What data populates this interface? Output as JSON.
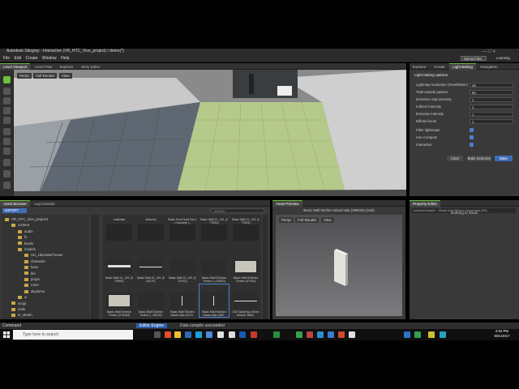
{
  "window": {
    "title": "Autodesk Stingray - Interactive (VR_HTC_Vive_project) / demo(*)",
    "account": "Samuel Ma",
    "learning": "Learning"
  },
  "menu": [
    "File",
    "Edit",
    "Create",
    "Window",
    "Help"
  ],
  "top_tabs": {
    "left": [
      "Level Viewport",
      "Level Flow",
      "Explorer",
      "Story Editor"
    ],
    "right": [
      "Explorer",
      "Create",
      "Light Baking",
      "Navigation"
    ]
  },
  "viewport": {
    "buttons": [
      "Persp",
      "Full Render",
      "View"
    ]
  },
  "light_baking": {
    "section": "Light baking options",
    "rows": [
      {
        "label": "Lightmap resolution (Texel/Meter)",
        "value": "16"
      },
      {
        "label": "Total sample passes",
        "value": "64"
      },
      {
        "label": "Emissive map intensity",
        "value": "1"
      },
      {
        "label": "Indirect intensity",
        "value": "1"
      },
      {
        "label": "Emissive intensity",
        "value": "1"
      },
      {
        "label": "Diffuse boost",
        "value": "1"
      }
    ],
    "checks": [
      "Filter lightmaps",
      "Use Compute",
      "Interactive"
    ],
    "buttons": {
      "clear": "Clear",
      "bake_selection": "Bake Selection",
      "bake": "Bake"
    }
  },
  "asset_browser": {
    "tabs": [
      "Asset Browser",
      "Log Console"
    ],
    "import_label": "IMPORT",
    "search_placeholder": "Search",
    "tree": [
      {
        "label": "VR_HTC_Vive_project1",
        "level": 0
      },
      {
        "label": "content",
        "level": 1
      },
      {
        "label": "audio",
        "level": 2
      },
      {
        "label": "fx",
        "level": 2
      },
      {
        "label": "levels",
        "level": 2
      },
      {
        "label": "models",
        "level": 2
      },
      {
        "label": "UU_Liberated house",
        "level": 3
      },
      {
        "label": "character",
        "level": 3
      },
      {
        "label": "base",
        "level": 3
      },
      {
        "label": "bin",
        "level": 3
      },
      {
        "label": "props",
        "level": 3
      },
      {
        "label": "room",
        "level": 3
      },
      {
        "label": "skydome",
        "level": 3
      },
      {
        "label": "ui",
        "level": 2
      },
      {
        "label": "script",
        "level": 1
      },
      {
        "label": "tools",
        "level": 1
      },
      {
        "label": "vr_steam",
        "level": 1
      }
    ],
    "grid": [
      {
        "label": "materials",
        "kind": "folder"
      },
      {
        "label": "textures",
        "kind": "folder"
      },
      {
        "label": "Basic Roof Gold Bar 1 - Concrete (...",
        "kind": "folder"
      },
      {
        "label": "Basic Wall CL_W1 (4 77600)",
        "kind": "folder"
      },
      {
        "label": "Basic Wall CL_W1 (4 77604)",
        "kind": "folder"
      },
      {
        "label": "Basic Wall CL_W1 (3 79969)",
        "kind": "flat"
      },
      {
        "label": "Basic Wall CL_W1 (3 46170)",
        "kind": "line"
      },
      {
        "label": "Basic Wall CL_W1 (3 37010)",
        "kind": "dark"
      },
      {
        "label": "Basic Wall Exterior Timber (..(43603)",
        "kind": "dark"
      },
      {
        "label": "Basic Wall Exterior Timber (47004)",
        "kind": "slab"
      },
      {
        "label": "Basic Wall Exterior Timber (278183)",
        "kind": "slab"
      },
      {
        "label": "Basic Wall Exterior Timber (.. 68126)",
        "kind": "dark"
      },
      {
        "label": "Basic Wall Kitchen Island slab (2479..",
        "kind": "pole"
      },
      {
        "label": "Basic Wall Kitchen Island slab (286..",
        "kind": "pole"
      },
      {
        "label": "CW Stair(Hop 40mm x40mm 3895..",
        "kind": "line"
      }
    ]
  },
  "asset_preview": {
    "title": "Asset Preview",
    "subtitle": "Basic Wall Kitchen Island slab (299025) (Unit)",
    "buttons": [
      "Persp",
      "Full Render",
      "View"
    ]
  },
  "property_editor": {
    "title": "Property Editor",
    "path": "content/models/ .../Basic Wall Kitchen Island slab (29)...",
    "empty": "Nothing to show"
  },
  "console": {
    "label": "Command",
    "status": "Data compile succeeded",
    "engine": "Editor Engine"
  },
  "taskbar": {
    "search_placeholder": "Type here to search",
    "time": "2:52 PM",
    "date": "9/21/2017"
  },
  "colors": {
    "accent_green": "#6fbf3a",
    "bake_blue": "#3e6db5"
  }
}
